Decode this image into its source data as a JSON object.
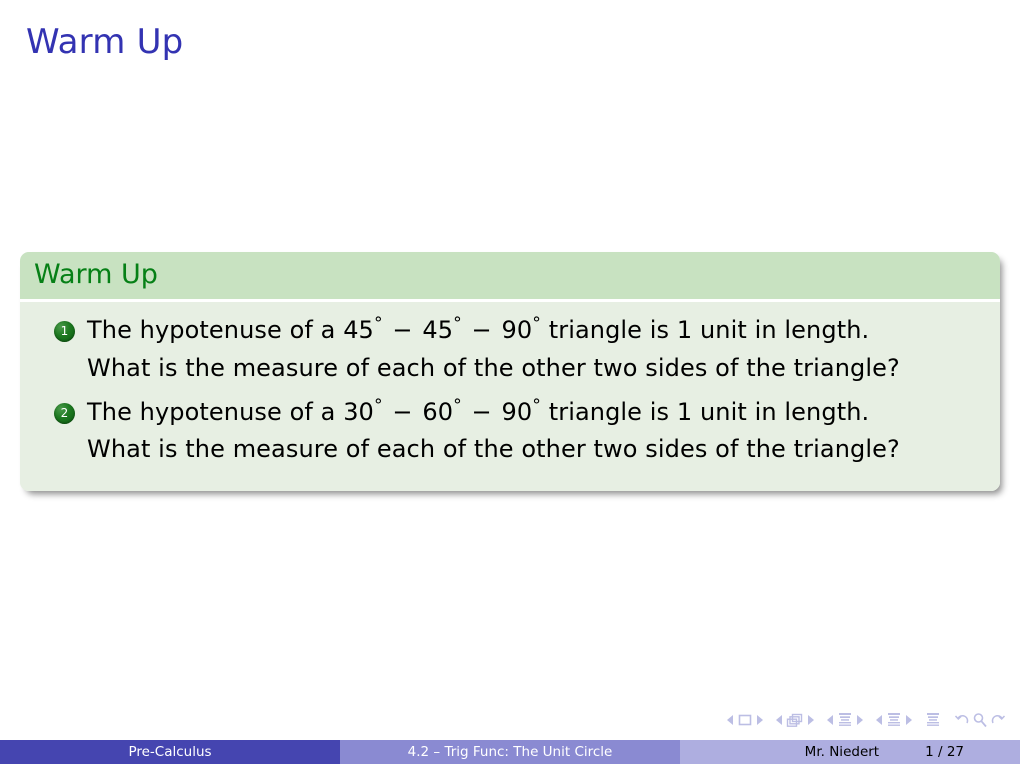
{
  "slide": {
    "title": "Warm Up",
    "page_background": "#ffffff",
    "title_color": "#3333b2"
  },
  "block": {
    "title": "Warm Up",
    "title_color": "#068016",
    "header_background": "#c8e2c1",
    "body_background": "#e7efe3",
    "items": [
      {
        "number": "1",
        "lines": [
          {
            "segments": [
              {
                "text": "The hypotenuse of a 45"
              },
              {
                "text": "°",
                "style": "degree"
              },
              {
                "text": " − ",
                "style": "dash"
              },
              {
                "text": "45"
              },
              {
                "text": "°",
                "style": "degree"
              },
              {
                "text": " − ",
                "style": "dash"
              },
              {
                "text": "90"
              },
              {
                "text": "°",
                "style": "degree"
              },
              {
                "text": " triangle is 1 unit in length."
              }
            ],
            "plain": "The hypotenuse of a 45° − 45° − 90° triangle is 1 unit in length."
          },
          {
            "segments": [
              {
                "text": "What is the measure of each of the other two sides of the triangle?"
              }
            ],
            "plain": "What is the measure of each of the other two sides of the triangle?"
          }
        ]
      },
      {
        "number": "2",
        "lines": [
          {
            "segments": [
              {
                "text": "The hypotenuse of a 30"
              },
              {
                "text": "°",
                "style": "degree"
              },
              {
                "text": " − ",
                "style": "dash"
              },
              {
                "text": "60"
              },
              {
                "text": "°",
                "style": "degree"
              },
              {
                "text": " − ",
                "style": "dash"
              },
              {
                "text": "90"
              },
              {
                "text": "°",
                "style": "degree"
              },
              {
                "text": " triangle is 1 unit in length."
              }
            ],
            "plain": "The hypotenuse of a 30° − 60° − 90° triangle is 1 unit in length."
          },
          {
            "segments": [
              {
                "text": "What is the measure of each of the other two sides of the triangle?"
              }
            ],
            "plain": "What is the measure of each of the other two sides of the triangle?"
          }
        ]
      }
    ]
  },
  "navigation": {
    "icon_color": "#b9bbe3",
    "groups": [
      {
        "icon": "slide-icon",
        "prev": "previous-slide-icon",
        "next": "next-slide-icon"
      },
      {
        "icon": "frame-icon",
        "prev": "previous-frame-icon",
        "next": "next-frame-icon"
      },
      {
        "icon": "subsection-icon",
        "prev": "previous-subsection-icon",
        "next": "next-subsection-icon"
      },
      {
        "icon": "section-icon",
        "prev": "previous-section-icon",
        "next": "next-section-icon"
      }
    ],
    "doc_icon": "document-icon",
    "back_icon": "back-icon",
    "search_icon": "search-icon",
    "forward_icon": "forward-icon"
  },
  "footer": {
    "author": "Pre-Calculus",
    "section": "4.2 – Trig Func: The Unit Circle",
    "presenter": "Mr. Niedert",
    "page": "1 / 27",
    "author_background": "#4545b0",
    "section_background": "#8a8ad2",
    "right_background": "#aeaee0"
  }
}
